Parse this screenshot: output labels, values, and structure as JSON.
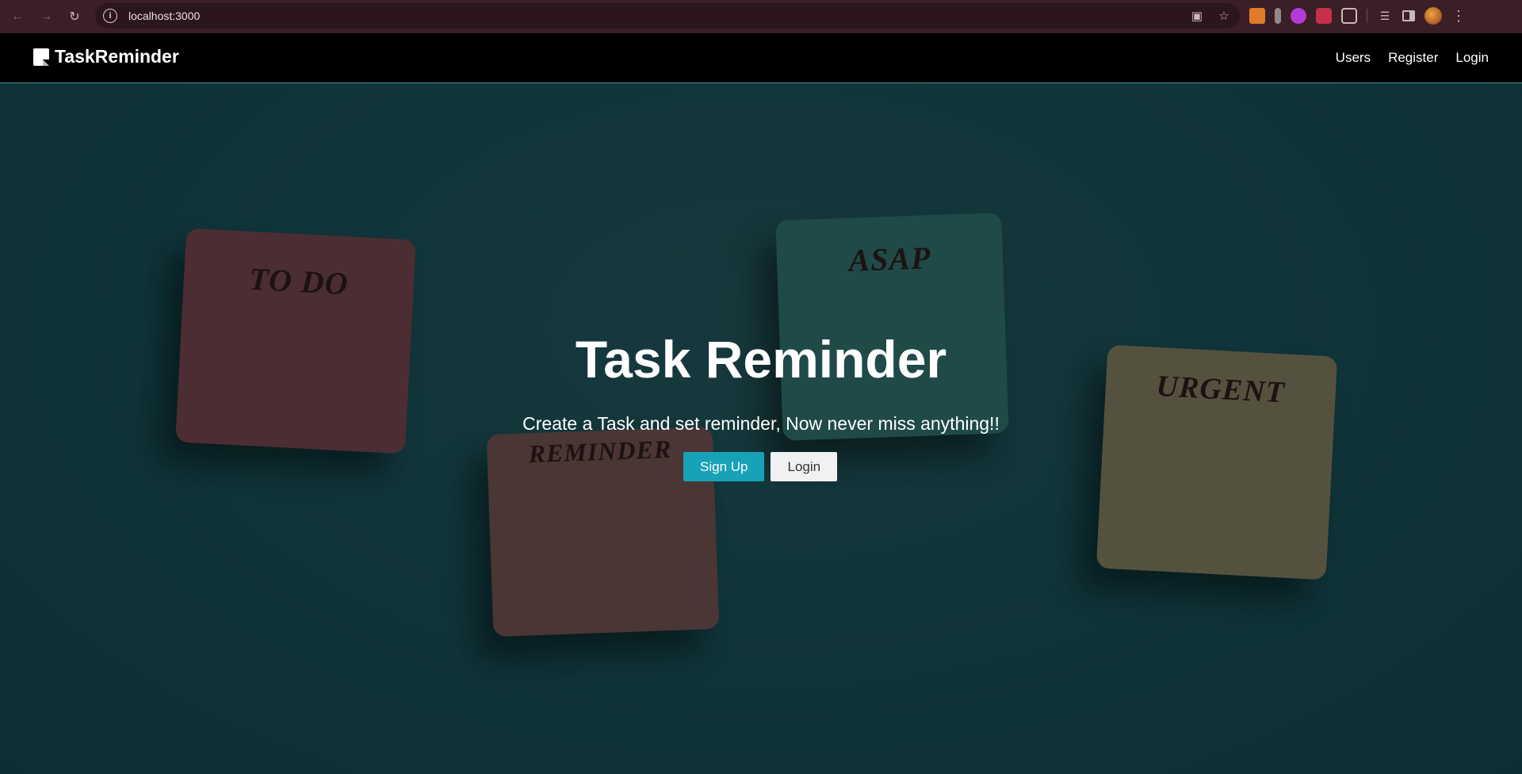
{
  "browser": {
    "url": "localhost:3000",
    "icons": {
      "back": "back-arrow-icon",
      "forward": "forward-arrow-icon",
      "reload": "reload-icon",
      "info": "info-icon",
      "install": "install-app-icon",
      "bookmark": "star-icon"
    }
  },
  "navbar": {
    "brand": "TaskReminder",
    "links": [
      "Users",
      "Register",
      "Login"
    ]
  },
  "hero": {
    "title": "Task Reminder",
    "subtitle": "Create a Task and set reminder, Now never miss anything!!",
    "signup_label": "Sign Up",
    "login_label": "Login",
    "notes": {
      "todo": "TO DO",
      "asap": "ASAP",
      "reminder": "REMINDER",
      "urgent": "URGENT"
    }
  },
  "colors": {
    "accent": "#17a2b8",
    "navbar_bg": "#000000",
    "hero_bg": "#10353a"
  }
}
